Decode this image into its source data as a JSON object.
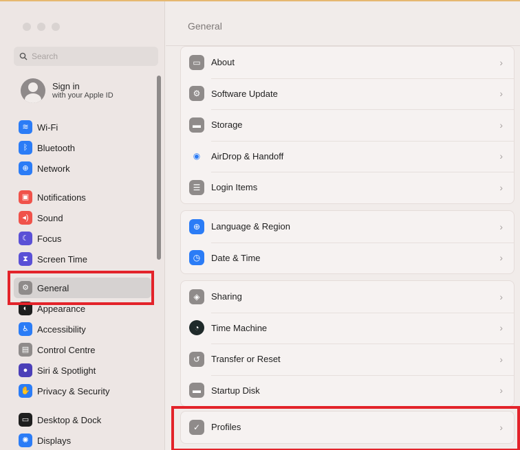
{
  "sidebar": {
    "search_placeholder": "Search",
    "account": {
      "title": "Sign in",
      "subtitle": "with your Apple ID"
    },
    "groups": [
      [
        {
          "label": "Wi-Fi",
          "icon": "wifi-icon",
          "color": "#2b7cf6",
          "glyph": "≋"
        },
        {
          "label": "Bluetooth",
          "icon": "bluetooth-icon",
          "color": "#2b7cf6",
          "glyph": "ᛒ"
        },
        {
          "label": "Network",
          "icon": "network-icon",
          "color": "#2b7cf6",
          "glyph": "⊕"
        }
      ],
      [
        {
          "label": "Notifications",
          "icon": "notifications-icon",
          "color": "#f0524a",
          "glyph": "▣"
        },
        {
          "label": "Sound",
          "icon": "sound-icon",
          "color": "#f0524a",
          "glyph": "◂)"
        },
        {
          "label": "Focus",
          "icon": "focus-icon",
          "color": "#5a50d6",
          "glyph": "☾"
        },
        {
          "label": "Screen Time",
          "icon": "screen-time-icon",
          "color": "#5a50d6",
          "glyph": "⧗"
        }
      ],
      [
        {
          "label": "General",
          "icon": "general-icon",
          "color": "#8f8b8a",
          "glyph": "⚙",
          "selected": true
        },
        {
          "label": "Appearance",
          "icon": "appearance-icon",
          "color": "#1e1e1e",
          "glyph": "◐"
        },
        {
          "label": "Accessibility",
          "icon": "accessibility-icon",
          "color": "#2b7cf6",
          "glyph": "♿"
        },
        {
          "label": "Control Centre",
          "icon": "control-centre-icon",
          "color": "#8f8b8a",
          "glyph": "▤"
        },
        {
          "label": "Siri & Spotlight",
          "icon": "siri-icon",
          "color": "#4b3fb8",
          "glyph": "●"
        },
        {
          "label": "Privacy & Security",
          "icon": "privacy-hand-icon",
          "color": "#2b7cf6",
          "glyph": "✋"
        }
      ],
      [
        {
          "label": "Desktop & Dock",
          "icon": "desktop-dock-icon",
          "color": "#1e1e1e",
          "glyph": "▭"
        },
        {
          "label": "Displays",
          "icon": "displays-icon",
          "color": "#2b7cf6",
          "glyph": "✺"
        }
      ]
    ]
  },
  "main": {
    "title": "General",
    "groups": [
      [
        {
          "label": "About",
          "icon": "about-icon",
          "color": "#8f8b8a",
          "glyph": "▭"
        },
        {
          "label": "Software Update",
          "icon": "software-update-icon",
          "color": "#8f8b8a",
          "glyph": "⚙"
        },
        {
          "label": "Storage",
          "icon": "storage-icon",
          "color": "#8f8b8a",
          "glyph": "▬"
        },
        {
          "label": "AirDrop & Handoff",
          "icon": "airdrop-icon",
          "color": "#f6f2f1",
          "glyph": "◉",
          "glyphColor": "#2b7cf6"
        },
        {
          "label": "Login Items",
          "icon": "login-items-icon",
          "color": "#8f8b8a",
          "glyph": "☰"
        }
      ],
      [
        {
          "label": "Language & Region",
          "icon": "language-globe-icon",
          "color": "#2b7cf6",
          "glyph": "⊕"
        },
        {
          "label": "Date & Time",
          "icon": "date-time-icon",
          "color": "#2b7cf6",
          "glyph": "◷"
        }
      ],
      [
        {
          "label": "Sharing",
          "icon": "sharing-icon",
          "color": "#8f8b8a",
          "glyph": "◈"
        },
        {
          "label": "Time Machine",
          "icon": "time-machine-icon",
          "color": "#1f2a2a",
          "glyph": "◔",
          "round": true
        },
        {
          "label": "Transfer or Reset",
          "icon": "transfer-reset-icon",
          "color": "#8f8b8a",
          "glyph": "↺"
        },
        {
          "label": "Startup Disk",
          "icon": "startup-disk-icon",
          "color": "#8f8b8a",
          "glyph": "▬"
        }
      ],
      [
        {
          "label": "Profiles",
          "icon": "profiles-check-icon",
          "color": "#8f8b8a",
          "glyph": "✓"
        }
      ]
    ]
  }
}
